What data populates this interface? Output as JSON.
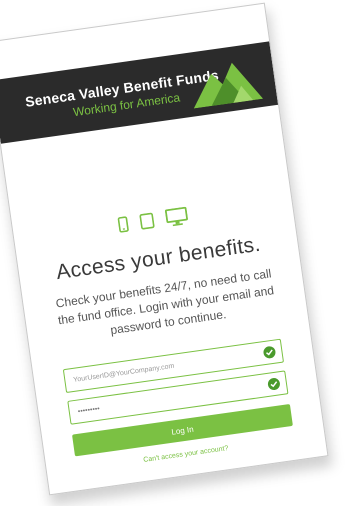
{
  "brand": {
    "name": "Seneca Valley Benefit Funds",
    "tagline": "Working for America"
  },
  "devices": [
    "phone-icon",
    "tablet-icon",
    "monitor-icon"
  ],
  "main": {
    "title": "Access your benefits.",
    "description": "Check your benefits 24/7, no need to call the fund office. Login with your email and password to continue."
  },
  "form": {
    "email_placeholder": "YourUserID@YourCompany.com",
    "password_value": "•••••••••",
    "login_label": "Log In",
    "cant_access_label": "Can't access your account?"
  },
  "colors": {
    "accent": "#7bc143",
    "header": "#2b2b2b",
    "check": "#4a9a2c"
  }
}
